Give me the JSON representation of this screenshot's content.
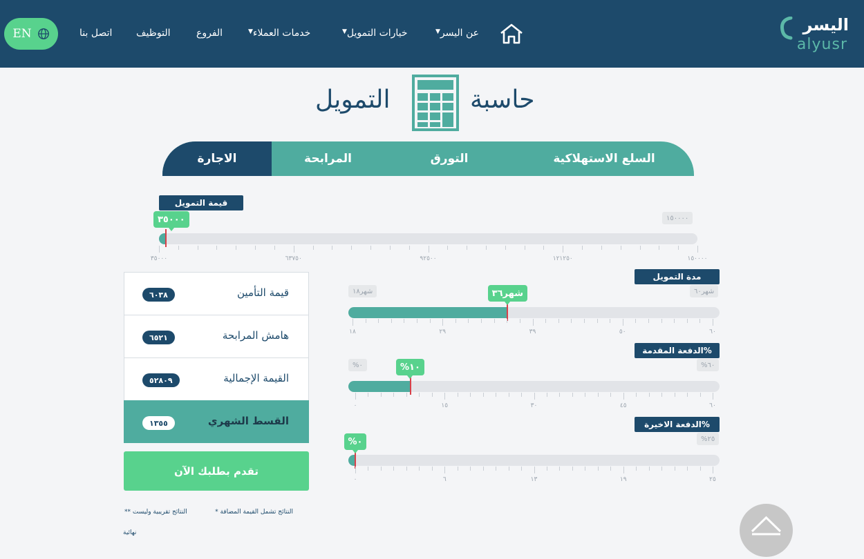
{
  "header": {
    "language_button": "EN",
    "nav": {
      "contact": "اتصل بنا",
      "jobs": "التوظيف",
      "branches": "الفروع",
      "customer_services": "خدمات العملاء",
      "financing_options": "خيارات التمويل",
      "about": "عن اليسر"
    },
    "logo_ar": "اليسر",
    "logo_en": "alyusr"
  },
  "title": {
    "word_right": "حاسبة",
    "word_left": "التمويل"
  },
  "tabs": [
    {
      "label": "السلع الاستهلاكية"
    },
    {
      "label": "التورق"
    },
    {
      "label": "المرابحة"
    },
    {
      "label": "الاجارة",
      "active": true
    }
  ],
  "amount_slider": {
    "label": "قيمة التمويل",
    "value_text": "٣٥٠٠٠",
    "max_text": "١٥٠٠٠٠",
    "fraction": 0.0,
    "tick_labels": [
      "٣٥٠٠٠",
      "٦٣٧٥٠",
      "٩٢٥٠٠",
      "١٢١٢٥٠",
      "١٥٠٠٠٠"
    ]
  },
  "duration_slider": {
    "label": "مدة التمويل",
    "value_text": "شهر٣٦",
    "min_text": "شهر١٨",
    "max_text": "شهر٦٠",
    "fraction": 0.4286,
    "tick_labels": [
      "١٨",
      "٢٩",
      "٣٩",
      "٥٠",
      "٦٠"
    ]
  },
  "downpayment_slider": {
    "label": "الدفعة المقدمة%",
    "value_text": "%١٠",
    "min_text": "%٠",
    "max_text": "%٦٠",
    "fraction": 0.1667,
    "tick_labels": [
      "٠",
      "١٥",
      "٣٠",
      "٤٥",
      "٦٠"
    ]
  },
  "final_payment_slider": {
    "label": "الدفعة الاخيرة%",
    "value_text": "%٠",
    "max_text": "%٢٥",
    "fraction": 0.0,
    "tick_labels": [
      "٠",
      "٦",
      "١٣",
      "١٩",
      "٢٥"
    ]
  },
  "results": [
    {
      "label": "قيمة التأمين",
      "value": "٦٠٣٨"
    },
    {
      "label": "هامش المرابحة",
      "value": "٦٥٢١"
    },
    {
      "label": "القيمة الإجمالية",
      "value": "٥٢٨٠٩"
    },
    {
      "label": "القسط الشهري",
      "value": "١٣٥٥",
      "highlight": true
    }
  ],
  "apply_button": "تقدم بطلبك الآن",
  "notes": {
    "note1": "*   النتائج تشمل القيمة المضافة",
    "note2": "**   النتائج تقريبية وليست",
    "note3": "نهائية"
  },
  "colors": {
    "navy": "#1d4a6b",
    "teal": "#4fac9f",
    "green": "#58d28d",
    "handle_red": "#d9404a"
  },
  "icons": [
    "globe-icon",
    "home-icon",
    "calculator-icon",
    "chevron-up-icon",
    "logo-mark-icon"
  ]
}
